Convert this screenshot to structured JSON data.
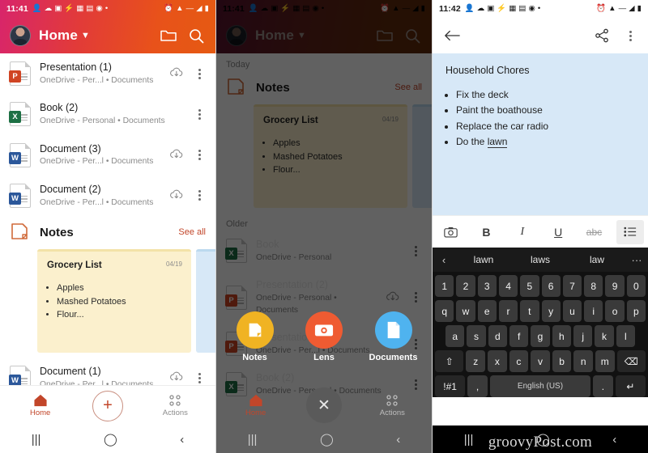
{
  "panels": {
    "home": {
      "status": {
        "clock": "11:41",
        "icons": [
          "person-icon",
          "chat-icon",
          "news-icon",
          "flash-icon",
          "photo-icon",
          "book-icon",
          "twitter-icon",
          "dot-icon"
        ],
        "right": [
          "alarm-icon",
          "wifi-icon",
          "lte-icon",
          "signal-icon",
          "battery-icon"
        ]
      },
      "appbar": {
        "title": "Home",
        "caret": "chevron-down-icon",
        "folder": "folder-icon",
        "search": "search-icon",
        "avatar": "avatar"
      },
      "files_top": [
        {
          "name": "Presentation (1)",
          "sub": "OneDrive - Per...l • Documents",
          "type": "ppt",
          "badge": "P",
          "cloud": true
        },
        {
          "name": "Book (2)",
          "sub": "OneDrive - Personal • Documents",
          "type": "xls",
          "badge": "X",
          "cloud": false
        },
        {
          "name": "Document (3)",
          "sub": "OneDrive - Per...l • Documents",
          "type": "doc",
          "badge": "W",
          "cloud": true
        },
        {
          "name": "Document (2)",
          "sub": "OneDrive - Per...l • Documents",
          "type": "doc",
          "badge": "W",
          "cloud": true
        }
      ],
      "notes_section": {
        "label": "Notes",
        "see_all": "See all",
        "icon": "sticky-note-icon"
      },
      "note_cards": [
        {
          "title": "Grocery List",
          "date": "04/19",
          "items": [
            "Apples",
            "Mashed Potatoes",
            "Flour..."
          ],
          "color": "yellow"
        },
        {
          "title": "",
          "date": "",
          "items": [],
          "color": "blue"
        }
      ],
      "files_bottom": [
        {
          "name": "Document (1)",
          "sub": "OneDrive - Per...l • Documents",
          "type": "doc",
          "badge": "W",
          "cloud": true
        }
      ],
      "bottom_nav": {
        "home": "Home",
        "actions": "Actions",
        "fab": "plus-icon"
      },
      "sysnav": {
        "recents": "recents-icon",
        "home": "home-circle-icon",
        "back": "back-icon"
      }
    },
    "menu": {
      "status": {
        "clock": "11:41"
      },
      "appbar": {
        "title": "Home"
      },
      "day_label": "Today",
      "notes_section": {
        "label": "Notes",
        "see_all": "See all"
      },
      "note_card": {
        "title": "Grocery List",
        "date": "04/19",
        "items": [
          "Apples",
          "Mashed Potatoes",
          "Flour..."
        ]
      },
      "older_label": "Older",
      "files": [
        {
          "name": "Book",
          "sub": "OneDrive - Personal",
          "type": "xls",
          "badge": "X"
        },
        {
          "name": "Presentation (2)",
          "sub": "OneDrive - Personal • Documents",
          "type": "ppt",
          "badge": "P"
        },
        {
          "name": "Presentation (1)",
          "sub": "OneDrive - Per...l • Documents",
          "type": "ppt",
          "badge": "P"
        },
        {
          "name": "Book (2)",
          "sub": "OneDrive - Personal • Documents",
          "type": "xls",
          "badge": "X"
        }
      ],
      "actions": [
        {
          "label": "Notes",
          "icon": "sticky-note-icon",
          "color": "#f0b323"
        },
        {
          "label": "Lens",
          "icon": "camera-icon",
          "color": "#ef5b32"
        },
        {
          "label": "Documents",
          "icon": "document-icon",
          "color": "#4fb3ef"
        }
      ],
      "bottom_nav": {
        "home": "Home",
        "actions": "Actions",
        "fab": "close-icon"
      }
    },
    "editor": {
      "status": {
        "clock": "11:42"
      },
      "appbar": {
        "back": "back-arrow-icon",
        "share": "share-icon",
        "more": "more-vertical-icon"
      },
      "note": {
        "title": "Household Chores",
        "items": [
          "Fix the deck",
          "Paint the boathouse",
          "Replace the car radio"
        ],
        "composing_prefix": "Do the ",
        "composing_word": "lawn"
      },
      "format_toolbar": [
        {
          "name": "camera-icon",
          "label": "■",
          "selected": false
        },
        {
          "name": "bold-button",
          "label": "B",
          "selected": false
        },
        {
          "name": "italic-button",
          "label": "I",
          "selected": false
        },
        {
          "name": "underline-button",
          "label": "U",
          "selected": false
        },
        {
          "name": "strikethrough-button",
          "label": "abc",
          "selected": false
        },
        {
          "name": "bullet-list-button",
          "label": "☰",
          "selected": true
        }
      ],
      "suggestions": {
        "left": "‹",
        "words": [
          "lawn",
          "laws",
          "law"
        ],
        "more": "···"
      },
      "keyboard": {
        "row_numbers": [
          "1",
          "2",
          "3",
          "4",
          "5",
          "6",
          "7",
          "8",
          "9",
          "0"
        ],
        "row_1": [
          "q",
          "w",
          "e",
          "r",
          "t",
          "y",
          "u",
          "i",
          "o",
          "p"
        ],
        "row_2": [
          "a",
          "s",
          "d",
          "f",
          "g",
          "h",
          "j",
          "k",
          "l"
        ],
        "row_3": [
          "⇧",
          "z",
          "x",
          "c",
          "v",
          "b",
          "n",
          "m",
          "⌫"
        ],
        "row_4": [
          "!#1",
          ",",
          "English (US)",
          ".",
          "↵"
        ]
      }
    }
  },
  "watermark": "groovyPost.com",
  "colors": {
    "brand_orange": "#e8521a",
    "brand_pink": "#d8256b",
    "accent_red": "#c2462a",
    "note_yellow": "#fbf0cd",
    "note_blue": "#d7e8f7",
    "ppt": "#d04423",
    "xls": "#1d7044",
    "doc": "#2b579a"
  }
}
